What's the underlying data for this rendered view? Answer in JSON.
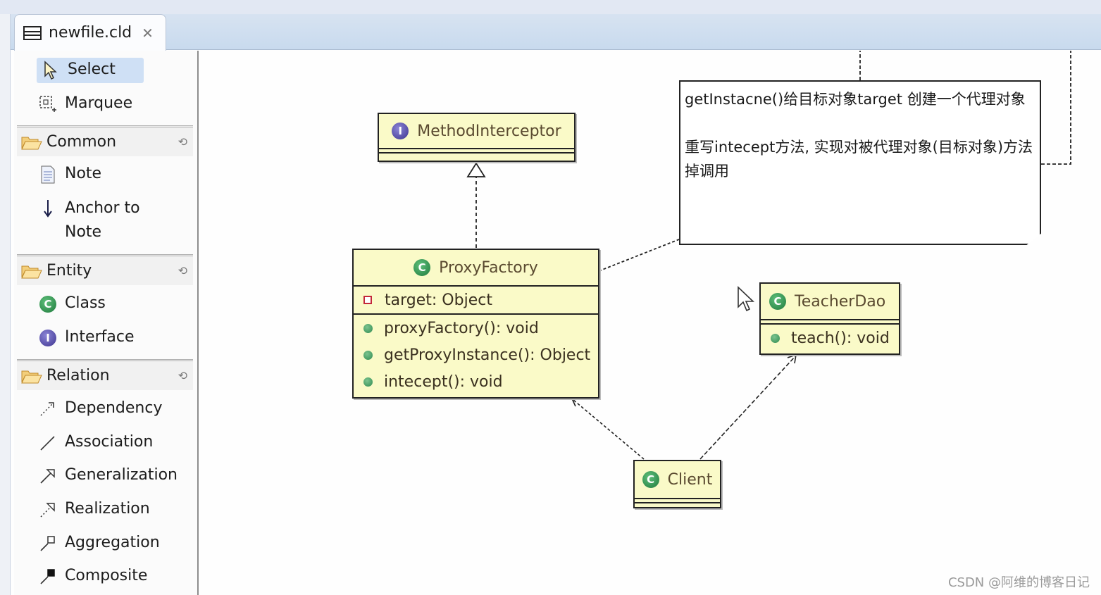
{
  "editor": {
    "tab_title": "newfile.cld",
    "tab_close_icon": "close-icon"
  },
  "palette": {
    "tools": [
      {
        "label": "Select",
        "icon": "arrow-cursor-icon",
        "selected": true
      },
      {
        "label": "Marquee",
        "icon": "marquee-icon",
        "selected": false
      }
    ],
    "drawers": [
      {
        "label": "Common",
        "items": [
          {
            "label": "Note",
            "icon": "note-icon"
          },
          {
            "label": "Anchor to Note",
            "line1": "Anchor to",
            "line2": "Note",
            "icon": "down-arrow-icon"
          }
        ]
      },
      {
        "label": "Entity",
        "items": [
          {
            "label": "Class",
            "icon": "class-icon"
          },
          {
            "label": "Interface",
            "icon": "interface-icon"
          }
        ]
      },
      {
        "label": "Relation",
        "items": [
          {
            "label": "Dependency",
            "icon": "dependency-icon"
          },
          {
            "label": "Association",
            "icon": "association-icon"
          },
          {
            "label": "Generalization",
            "icon": "generalization-icon"
          },
          {
            "label": "Realization",
            "icon": "realization-icon"
          },
          {
            "label": "Aggregation",
            "icon": "aggregation-icon"
          },
          {
            "label": "Composite",
            "icon": "composite-icon"
          }
        ]
      }
    ]
  },
  "diagram": {
    "method_interceptor": {
      "name": "MethodInterceptor",
      "kind": "interface",
      "badge": "I"
    },
    "proxy_factory": {
      "name": "ProxyFactory",
      "kind": "class",
      "badge": "C",
      "fields": [
        "target: Object"
      ],
      "methods": [
        "proxyFactory(): void",
        "getProxyInstance(): Object",
        "intecept(): void"
      ]
    },
    "teacher_dao": {
      "name": "TeacherDao",
      "kind": "class",
      "badge": "C",
      "methods": [
        "teach(): void"
      ]
    },
    "client": {
      "name": "Client",
      "kind": "class",
      "badge": "C"
    },
    "note": {
      "para1": "getInstacne()给目标对象target 创建一个代理对象",
      "para2": "重写intecept方法, 实现对被代理对象(目标对象)方法掉调用"
    }
  },
  "watermark": "CSDN @阿维的博客日记"
}
